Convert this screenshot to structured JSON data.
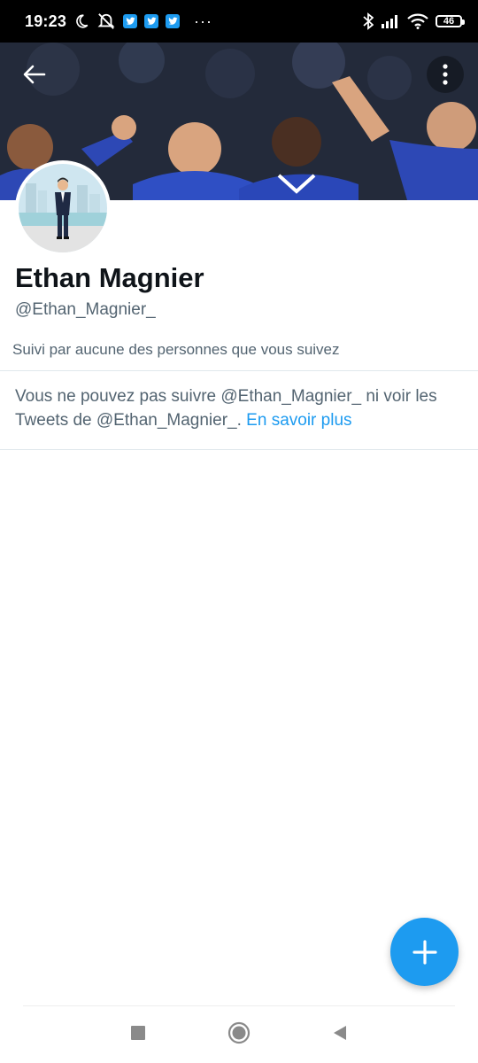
{
  "status_bar": {
    "time": "19:23",
    "more": "···",
    "battery": "46",
    "icons": [
      "moon-icon",
      "alarm-off-icon",
      "twitter-icon",
      "twitter-icon",
      "twitter-icon",
      "bluetooth-icon",
      "signal-icon",
      "wifi-icon",
      "battery-icon"
    ]
  },
  "profile": {
    "name": "Ethan Magnier",
    "handle": "@Ethan_Magnier_",
    "followed_by": "Suivi par aucune des personnes que vous suivez"
  },
  "notice": {
    "text": "Vous ne pouvez pas suivre @Ethan_Magnier_ ni voir les Tweets de @Ethan_Magnier_.",
    "link": "En savoir plus"
  },
  "colors": {
    "accent": "#1d9bf0",
    "secondary_text": "#536471",
    "primary_text": "#0f1419"
  }
}
